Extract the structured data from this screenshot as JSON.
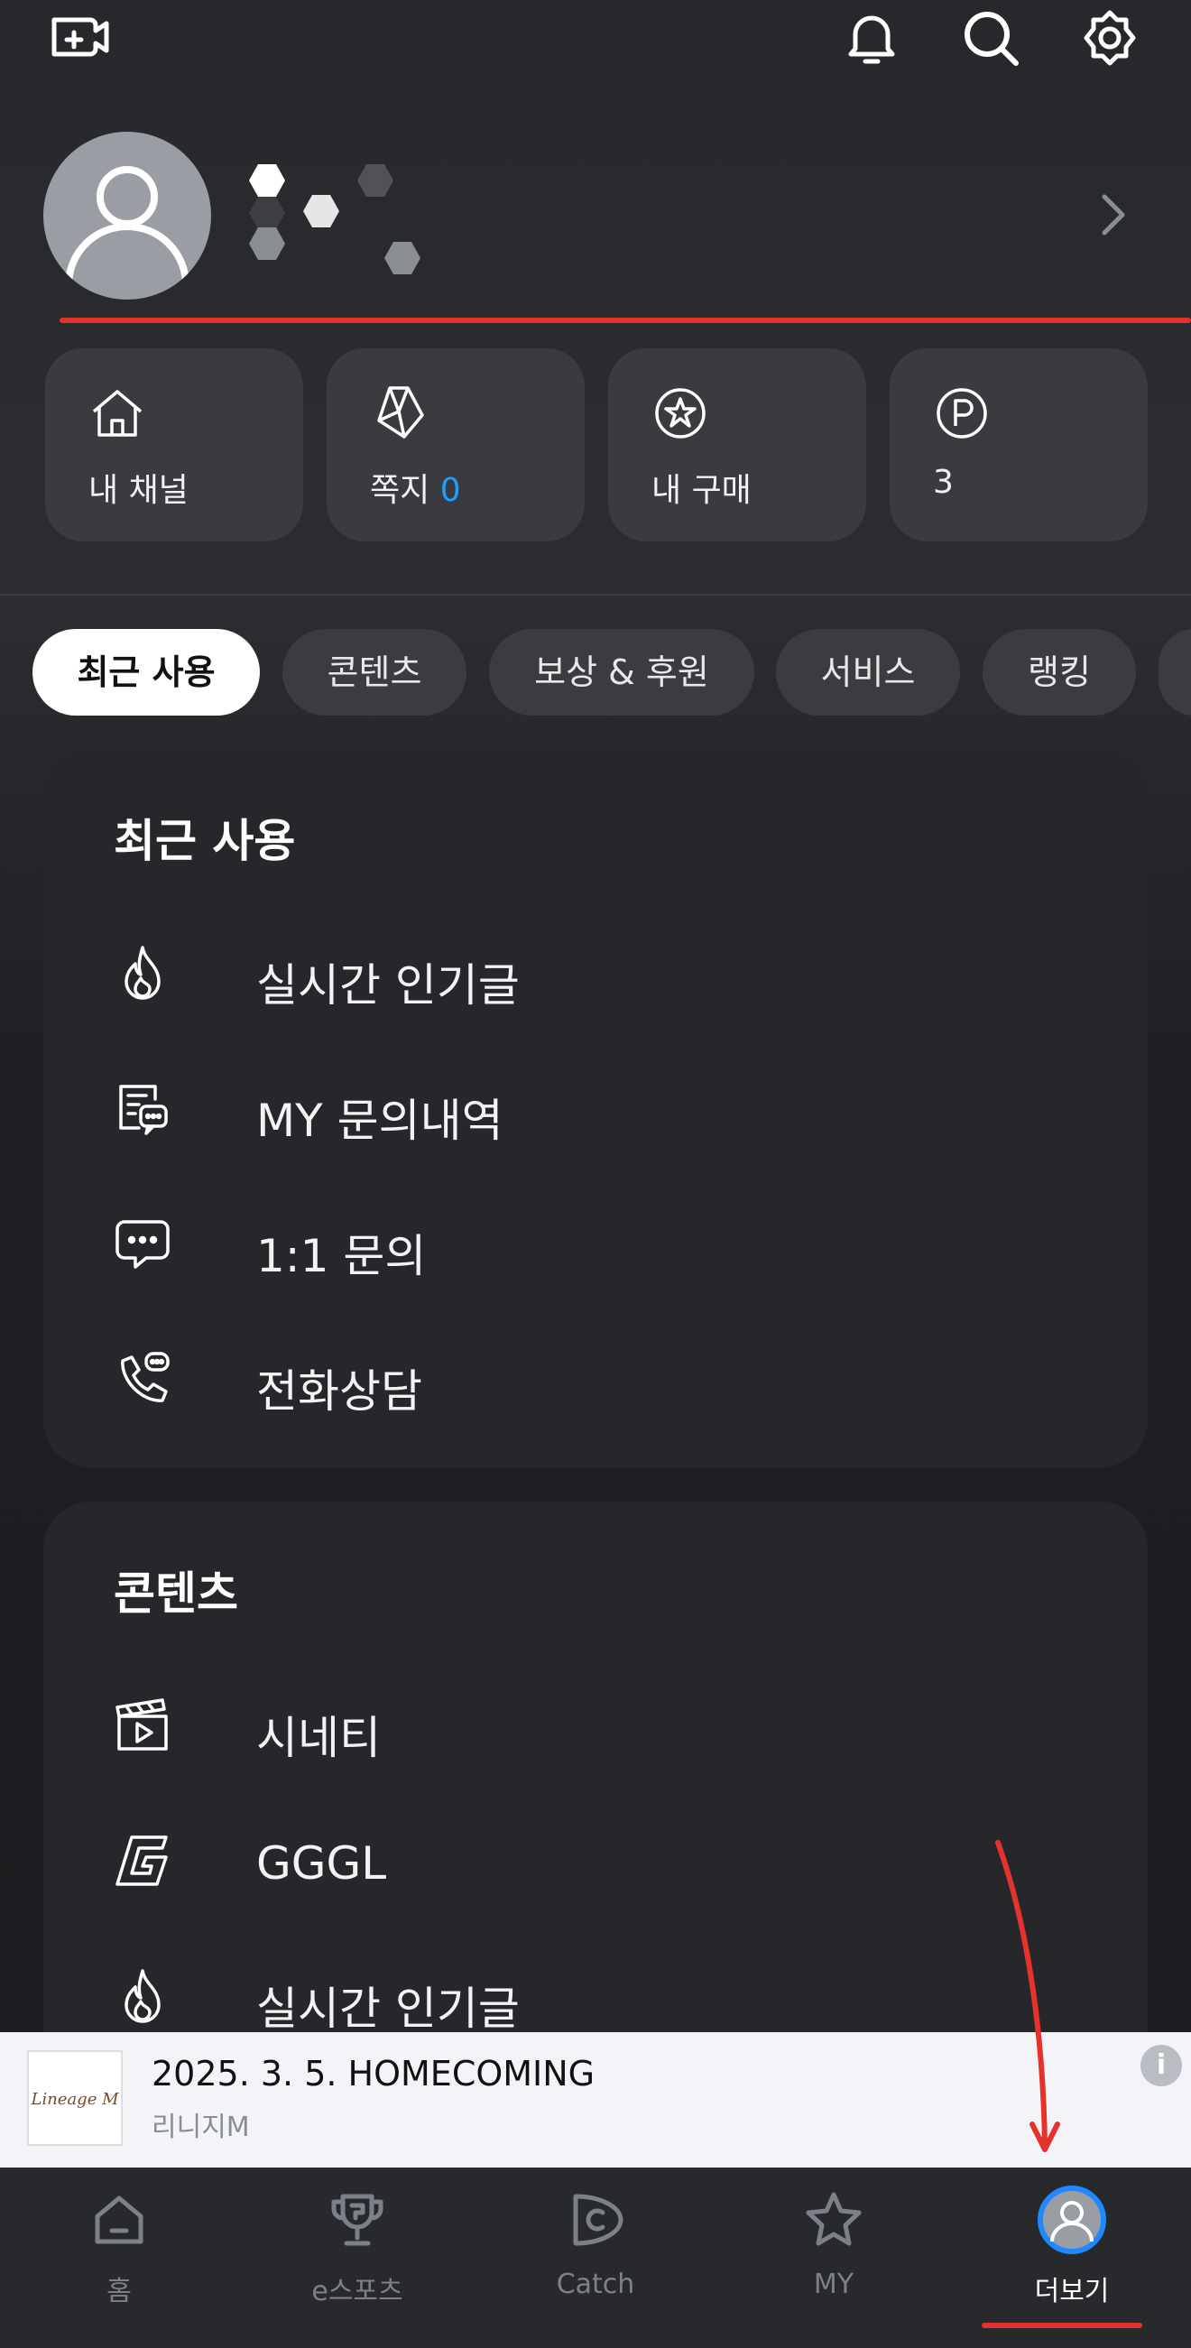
{
  "top_bar": {
    "icons": [
      "create-stream-icon",
      "bell-icon",
      "search-icon",
      "gear-icon"
    ]
  },
  "profile": {
    "avatar": "default-avatar-icon",
    "name_state": "loading"
  },
  "quick_menu": [
    {
      "icon": "house-icon",
      "label": "내 채널"
    },
    {
      "icon": "note-icon",
      "label": "쪽지",
      "count": "0"
    },
    {
      "icon": "star-circle-icon",
      "label": "내 구매"
    },
    {
      "icon": "point-icon",
      "label": "3"
    }
  ],
  "tabs": [
    {
      "label": "최근 사용",
      "active": true
    },
    {
      "label": "콘텐츠"
    },
    {
      "label": "보상 & 후원"
    },
    {
      "label": "서비스"
    },
    {
      "label": "랭킹"
    }
  ],
  "recent": {
    "title": "최근 사용",
    "items": [
      {
        "icon": "flame-icon",
        "label": "실시간 인기글"
      },
      {
        "icon": "inquiry-list-icon",
        "label": "MY 문의내역"
      },
      {
        "icon": "chat-bubble-icon",
        "label": "1:1 문의"
      },
      {
        "icon": "phone-chat-icon",
        "label": "전화상담"
      }
    ]
  },
  "contents": {
    "title": "콘텐츠",
    "items": [
      {
        "icon": "clapperboard-icon",
        "label": "시네티"
      },
      {
        "icon": "gggl-logo-icon",
        "label": "GGGL"
      },
      {
        "icon": "flame-icon",
        "label": "실시간 인기글"
      }
    ]
  },
  "ad": {
    "thumb_text": "Lineage M",
    "title": "2025. 3. 5. HOMECOMING",
    "subtitle": "리니지M",
    "info_glyph": "i"
  },
  "bottom_nav": [
    {
      "icon": "home-icon",
      "label": "홈"
    },
    {
      "icon": "trophy-icon",
      "label": "e스포츠"
    },
    {
      "icon": "catch-icon",
      "label": "Catch"
    },
    {
      "icon": "star-icon",
      "label": "MY"
    },
    {
      "icon": "profile-icon",
      "label": "더보기",
      "active": true
    }
  ],
  "colors": {
    "accent_blue": "#1aa0ff",
    "annotation_red": "#e5322d",
    "card_bg": "#393b40",
    "panel_bg": "#25272b"
  }
}
